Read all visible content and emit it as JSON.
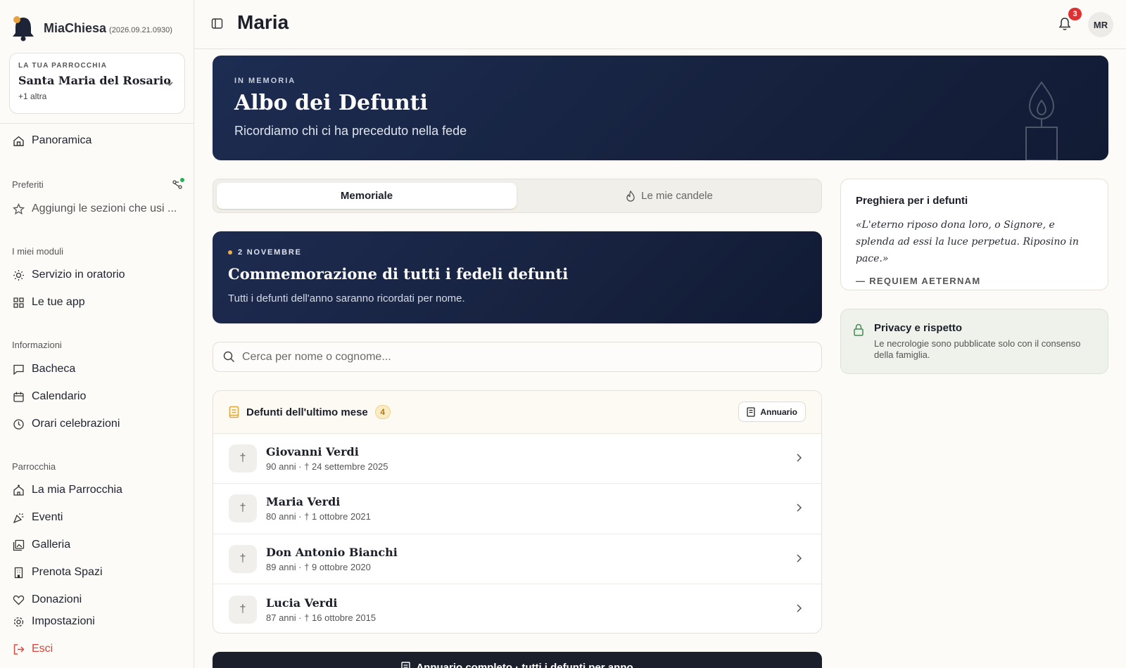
{
  "app": {
    "name": "MiaChiesa",
    "version": "(2026.09.21.0930)"
  },
  "parish": {
    "kicker": "LA TUA PARROCCHIA",
    "name": "Santa Maria del Rosario",
    "more": "+1 altra"
  },
  "nav": {
    "overview": "Panoramica",
    "favorites_label": "Preferiti",
    "favorites_hint": "Aggiungi le sezioni che usi ...",
    "modules_label": "I miei moduli",
    "modules": [
      "Servizio in oratorio",
      "Le tue app"
    ],
    "info_label": "Informazioni",
    "info": [
      "Bacheca",
      "Calendario",
      "Orari celebrazioni"
    ],
    "parish_label": "Parrocchia",
    "parish_items": [
      "La mia Parrocchia",
      "Eventi",
      "Galleria",
      "Prenota Spazi",
      "Donazioni"
    ],
    "settings": "Impostazioni",
    "logout": "Esci"
  },
  "header": {
    "title": "Maria",
    "notifications": "3",
    "avatar": "MR"
  },
  "hero": {
    "kicker": "IN MEMORIA",
    "title": "Albo dei Defunti",
    "subtitle": "Ricordiamo chi ci ha preceduto nella fede"
  },
  "tabs": [
    {
      "label": "Memoriale",
      "active": true
    },
    {
      "label": "Le mie candele",
      "active": false
    }
  ],
  "commemoration": {
    "kicker": "2 NOVEMBRE",
    "title": "Commemorazione di tutti i fedeli defunti",
    "subtitle": "Tutti i defunti dell'anno saranno ricordati per nome."
  },
  "search": {
    "placeholder": "Cerca per nome o cognome...",
    "value": ""
  },
  "list": {
    "title": "Defunti dell'ultimo mese",
    "count": "4",
    "annuario_label": "Annuario",
    "items": [
      {
        "name": "Giovanni Verdi",
        "meta": "90 anni · † 24 settembre 2025"
      },
      {
        "name": "Maria Verdi",
        "meta": "80 anni · † 1 ottobre 2021"
      },
      {
        "name": "Don Antonio Bianchi",
        "meta": "89 anni · † 9 ottobre 2020"
      },
      {
        "name": "Lucia Verdi",
        "meta": "87 anni · † 16 ottobre 2015"
      }
    ]
  },
  "bottom_button": "Annuario completo · tutti i defunti per anno",
  "prayer": {
    "title": "Preghiera per i defunti",
    "text": "«L'eterno riposo dona loro, o Signore, e splenda ad essi la luce perpetua. Riposino in pace.»",
    "source": "— REQUIEM AETERNAM"
  },
  "privacy": {
    "title": "Privacy e rispetto",
    "text": "Le necrologie sono pubblicate solo con il consenso della famiglia."
  },
  "colors": {
    "navy": "#16223f",
    "accent": "#e8b04a",
    "danger": "#d9443a",
    "badge": "#e03131",
    "privacy_bg": "#eef2ea"
  }
}
